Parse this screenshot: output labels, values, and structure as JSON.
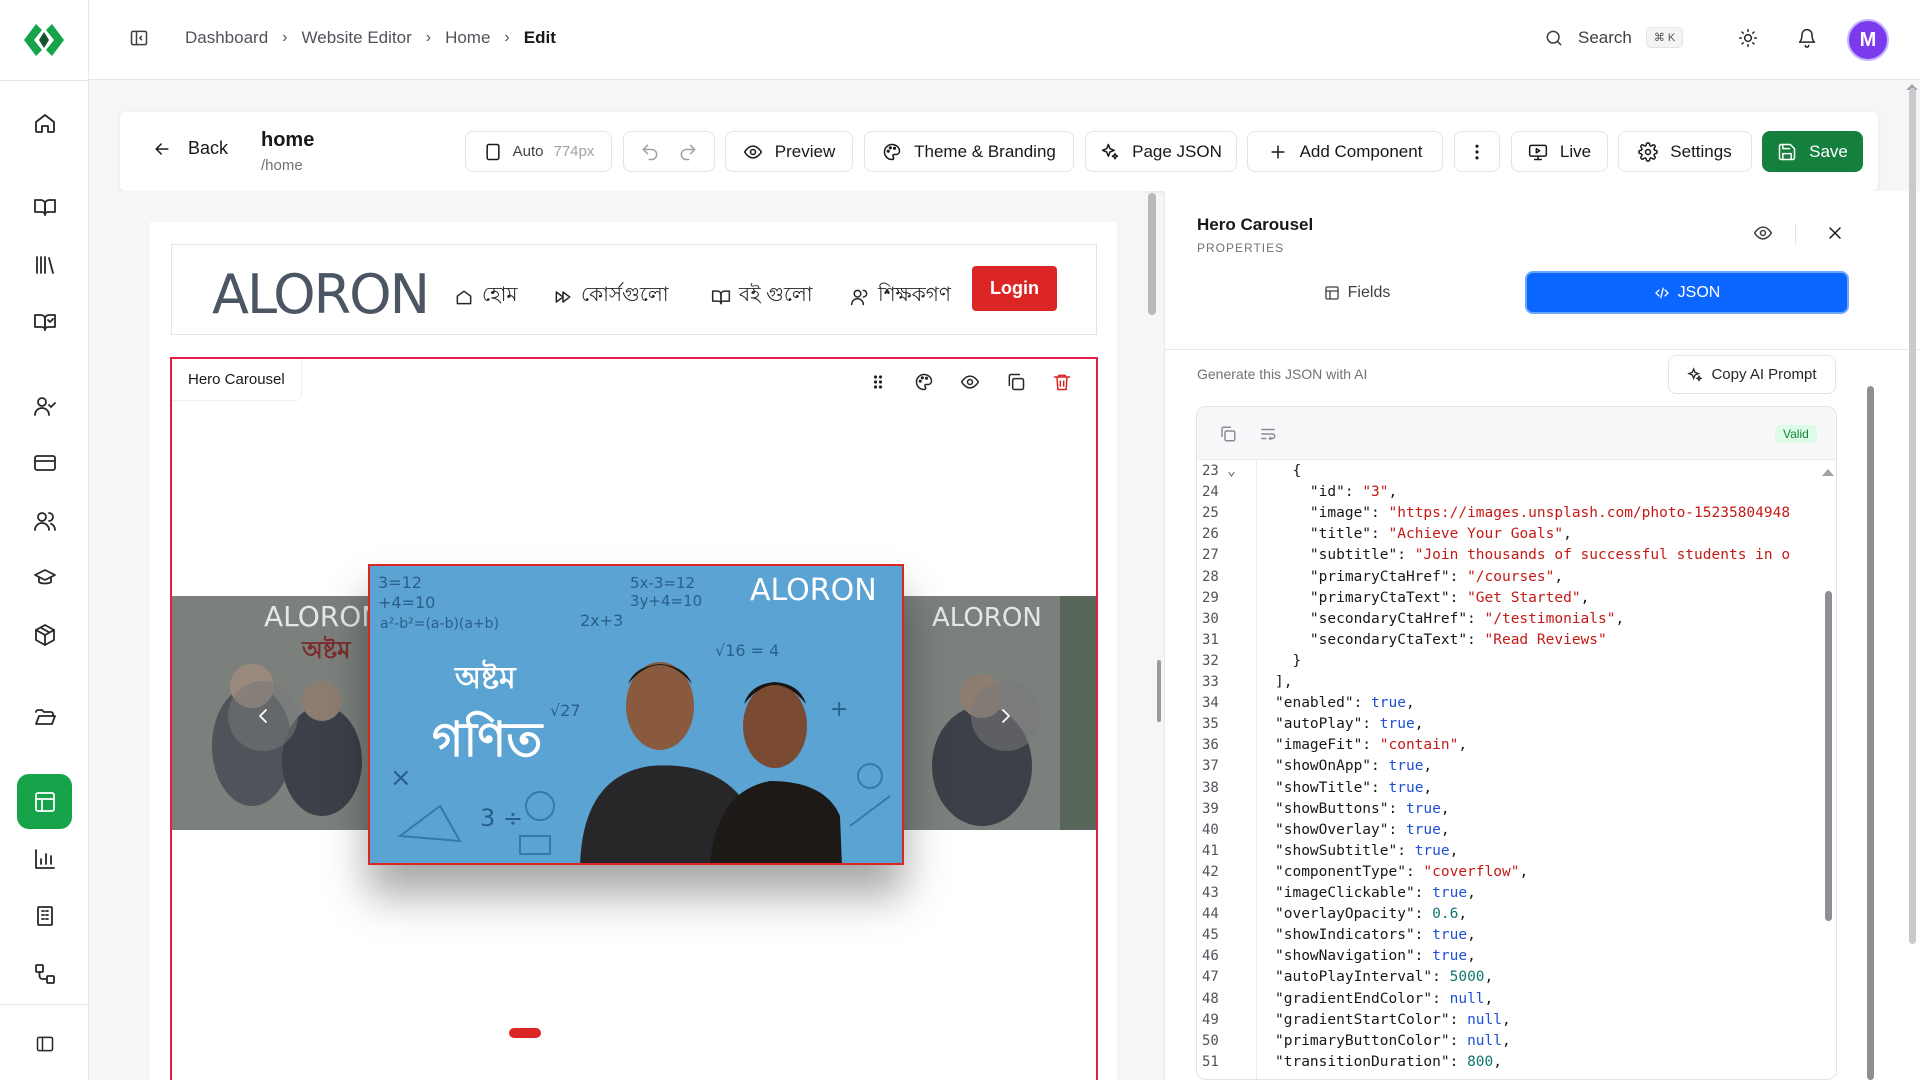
{
  "breadcrumb": [
    "Dashboard",
    "Website Editor",
    "Home",
    "Edit"
  ],
  "search": {
    "label": "Search",
    "shortcut": "⌘ K"
  },
  "user": {
    "avatar_initial": "M"
  },
  "toolbar": {
    "back": "Back",
    "page_name": "home",
    "page_path": "/home",
    "width_mode": "Auto",
    "width_px": "774px",
    "preview": "Preview",
    "theme": "Theme & Branding",
    "page_json": "Page JSON",
    "add_component": "Add Component",
    "live": "Live",
    "settings": "Settings",
    "save": "Save"
  },
  "site_header": {
    "brand": "ALORON",
    "nav": [
      "হোম",
      "কোর্সগুলো",
      "বই গুলো",
      "শিক্ষকগণ"
    ],
    "login": "Login"
  },
  "hero": {
    "label": "Hero Carousel",
    "slide_brand": "ALORON",
    "slide_title_1": "অষ্টম",
    "slide_title_2": "গণিত",
    "side_brand": "ALORON",
    "side_text": "অষ্টম"
  },
  "panel": {
    "title": "Hero Carousel",
    "subtitle": "PROPERTIES",
    "tab_fields": "Fields",
    "tab_json": "JSON",
    "gen_label": "Generate this JSON with AI",
    "copy_prompt": "Copy AI Prompt",
    "valid": "Valid"
  },
  "colors": {
    "accent_green": "#15803d",
    "json_tab": "#0a66ff",
    "danger": "#dc2626",
    "avatar": "#7c3aed"
  },
  "code_lines": [
    {
      "n": "23",
      "fold": true,
      "t": [
        [
          "k",
          "  {"
        ]
      ]
    },
    {
      "n": "24",
      "t": [
        [
          "k",
          "    \"id\": "
        ],
        [
          "s",
          "\"3\""
        ],
        [
          "k",
          ","
        ]
      ]
    },
    {
      "n": "25",
      "t": [
        [
          "k",
          "    \"image\": "
        ],
        [
          "s",
          "\"https://images.unsplash.com/photo-15235804948"
        ]
      ]
    },
    {
      "n": "26",
      "t": [
        [
          "k",
          "    \"title\": "
        ],
        [
          "s",
          "\"Achieve Your Goals\""
        ],
        [
          "k",
          ","
        ]
      ]
    },
    {
      "n": "27",
      "t": [
        [
          "k",
          "    \"subtitle\": "
        ],
        [
          "s",
          "\"Join thousands of successful students in o"
        ]
      ]
    },
    {
      "n": "28",
      "t": [
        [
          "k",
          "    \"primaryCtaHref\": "
        ],
        [
          "s",
          "\"/courses\""
        ],
        [
          "k",
          ","
        ]
      ]
    },
    {
      "n": "29",
      "t": [
        [
          "k",
          "    \"primaryCtaText\": "
        ],
        [
          "s",
          "\"Get Started\""
        ],
        [
          "k",
          ","
        ]
      ]
    },
    {
      "n": "30",
      "t": [
        [
          "k",
          "    \"secondaryCtaHref\": "
        ],
        [
          "s",
          "\"/testimonials\""
        ],
        [
          "k",
          ","
        ]
      ]
    },
    {
      "n": "31",
      "t": [
        [
          "k",
          "    \"secondaryCtaText\": "
        ],
        [
          "s",
          "\"Read Reviews\""
        ]
      ]
    },
    {
      "n": "32",
      "t": [
        [
          "k",
          "  }"
        ]
      ]
    },
    {
      "n": "33",
      "t": [
        [
          "k",
          "],"
        ]
      ]
    },
    {
      "n": "34",
      "t": [
        [
          "k",
          "\"enabled\": "
        ],
        [
          "b",
          "true"
        ],
        [
          "k",
          ","
        ]
      ]
    },
    {
      "n": "35",
      "t": [
        [
          "k",
          "\"autoPlay\": "
        ],
        [
          "b",
          "true"
        ],
        [
          "k",
          ","
        ]
      ]
    },
    {
      "n": "36",
      "t": [
        [
          "k",
          "\"imageFit\": "
        ],
        [
          "s",
          "\"contain\""
        ],
        [
          "k",
          ","
        ]
      ]
    },
    {
      "n": "37",
      "t": [
        [
          "k",
          "\"showOnApp\": "
        ],
        [
          "b",
          "true"
        ],
        [
          "k",
          ","
        ]
      ]
    },
    {
      "n": "38",
      "t": [
        [
          "k",
          "\"showTitle\": "
        ],
        [
          "b",
          "true"
        ],
        [
          "k",
          ","
        ]
      ]
    },
    {
      "n": "39",
      "t": [
        [
          "k",
          "\"showButtons\": "
        ],
        [
          "b",
          "true"
        ],
        [
          "k",
          ","
        ]
      ]
    },
    {
      "n": "40",
      "t": [
        [
          "k",
          "\"showOverlay\": "
        ],
        [
          "b",
          "true"
        ],
        [
          "k",
          ","
        ]
      ]
    },
    {
      "n": "41",
      "t": [
        [
          "k",
          "\"showSubtitle\": "
        ],
        [
          "b",
          "true"
        ],
        [
          "k",
          ","
        ]
      ]
    },
    {
      "n": "42",
      "t": [
        [
          "k",
          "\"componentType\": "
        ],
        [
          "s",
          "\"coverflow\""
        ],
        [
          "k",
          ","
        ]
      ]
    },
    {
      "n": "43",
      "t": [
        [
          "k",
          "\"imageClickable\": "
        ],
        [
          "b",
          "true"
        ],
        [
          "k",
          ","
        ]
      ]
    },
    {
      "n": "44",
      "t": [
        [
          "k",
          "\"overlayOpacity\": "
        ],
        [
          "n",
          "0.6"
        ],
        [
          "k",
          ","
        ]
      ]
    },
    {
      "n": "45",
      "t": [
        [
          "k",
          "\"showIndicators\": "
        ],
        [
          "b",
          "true"
        ],
        [
          "k",
          ","
        ]
      ]
    },
    {
      "n": "46",
      "t": [
        [
          "k",
          "\"showNavigation\": "
        ],
        [
          "b",
          "true"
        ],
        [
          "k",
          ","
        ]
      ]
    },
    {
      "n": "47",
      "t": [
        [
          "k",
          "\"autoPlayInterval\": "
        ],
        [
          "n",
          "5000"
        ],
        [
          "k",
          ","
        ]
      ]
    },
    {
      "n": "48",
      "t": [
        [
          "k",
          "\"gradientEndColor\": "
        ],
        [
          "b",
          "null"
        ],
        [
          "k",
          ","
        ]
      ]
    },
    {
      "n": "49",
      "t": [
        [
          "k",
          "\"gradientStartColor\": "
        ],
        [
          "b",
          "null"
        ],
        [
          "k",
          ","
        ]
      ]
    },
    {
      "n": "50",
      "t": [
        [
          "k",
          "\"primaryButtonColor\": "
        ],
        [
          "b",
          "null"
        ],
        [
          "k",
          ","
        ]
      ]
    },
    {
      "n": "51",
      "t": [
        [
          "k",
          "\"transitionDuration\": "
        ],
        [
          "n",
          "800"
        ],
        [
          "k",
          ","
        ]
      ]
    }
  ]
}
